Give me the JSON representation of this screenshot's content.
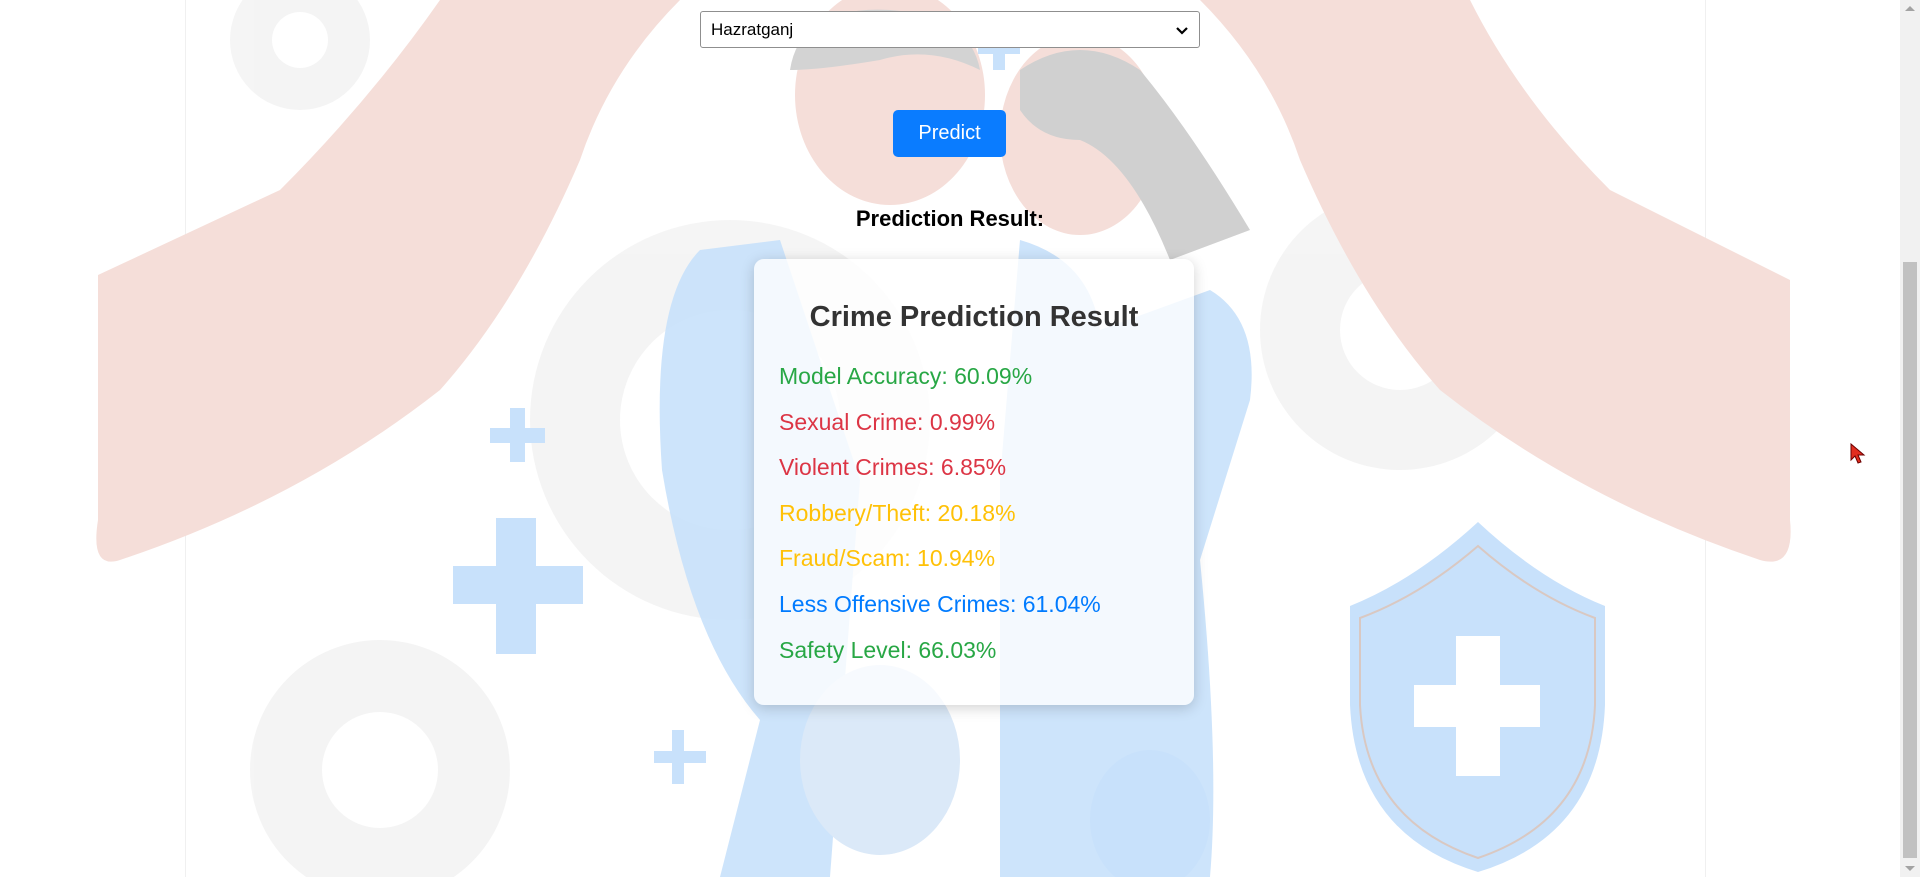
{
  "form": {
    "area_select": {
      "selected": "Hazratganj"
    },
    "predict_label": "Predict"
  },
  "result": {
    "heading": "Prediction Result:",
    "card_title": "Crime Prediction Result",
    "lines": [
      {
        "label": "Model Accuracy",
        "value": "60.09%",
        "color": "#28a745"
      },
      {
        "label": "Sexual Crime",
        "value": "0.99%",
        "color": "#dc3545"
      },
      {
        "label": "Violent Crimes",
        "value": "6.85%",
        "color": "#dc3545"
      },
      {
        "label": "Robbery/Theft",
        "value": "20.18%",
        "color": "#ffc107"
      },
      {
        "label": "Fraud/Scam",
        "value": "10.94%",
        "color": "#ffc107"
      },
      {
        "label": "Less Offensive Crimes",
        "value": "61.04%",
        "color": "#007bff"
      },
      {
        "label": "Safety Level",
        "value": "66.03%",
        "color": "#28a745"
      }
    ]
  },
  "icons": [
    "chevron-down-icon",
    "plus-icon",
    "shield-icon",
    "gear-icon",
    "mouse-cursor-icon"
  ],
  "colors": {
    "primary": "#0a7cff",
    "card_title": "#333333",
    "hand": "#f5ded9",
    "accent_light": "#c8e1fb"
  }
}
